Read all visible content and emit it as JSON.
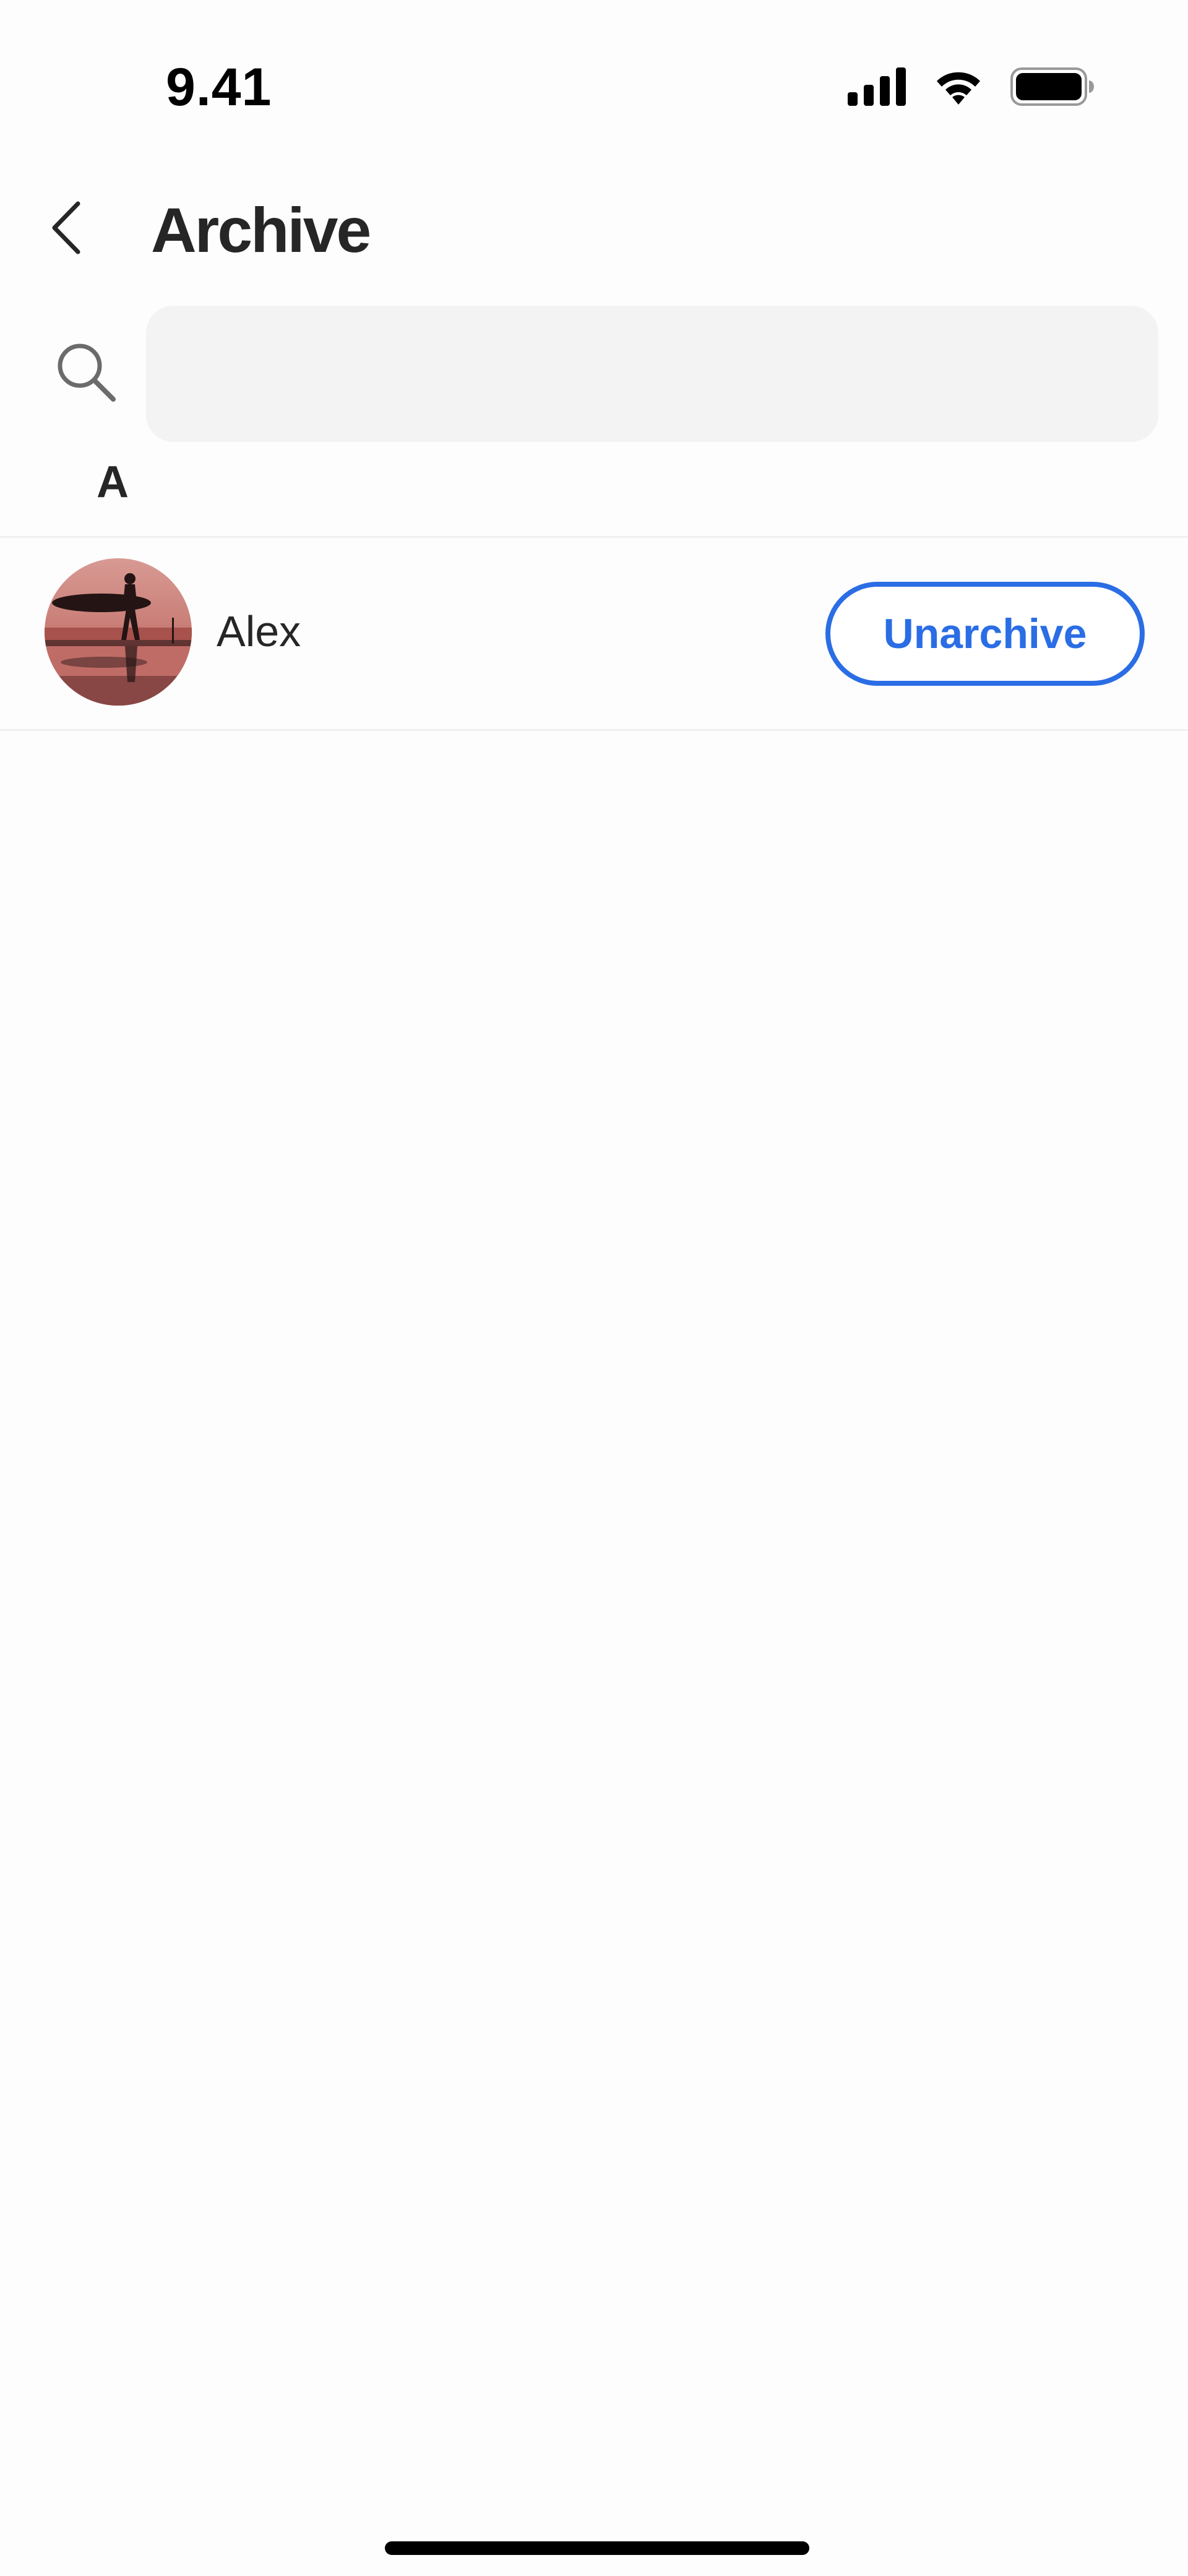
{
  "status_bar": {
    "time": "9.41",
    "icons": [
      "signal-icon",
      "wifi-icon",
      "battery-icon"
    ]
  },
  "header": {
    "back_icon": "chevron-left-icon",
    "title": "Archive"
  },
  "search": {
    "icon": "search-icon",
    "value": "",
    "placeholder": ""
  },
  "sections": [
    {
      "letter": "A",
      "contacts": [
        {
          "name": "Alex",
          "avatar": "surfer-sunset-photo",
          "action_label": "Unarchive"
        }
      ]
    }
  ],
  "colors": {
    "accent": "#2a6de5",
    "search_background": "#f3f3f3",
    "text": "#262626",
    "background": "#fdfdfd"
  }
}
